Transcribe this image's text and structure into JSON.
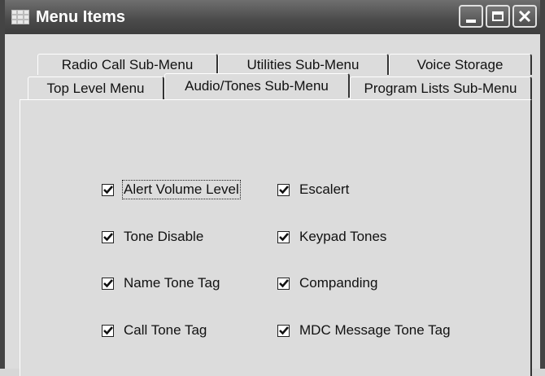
{
  "window": {
    "title": "Menu Items",
    "buttons": {
      "minimize": "minimize",
      "maximize": "maximize",
      "close": "close"
    }
  },
  "tabs": {
    "row1": [
      "Radio Call Sub-Menu",
      "Utilities Sub-Menu",
      "Voice Storage"
    ],
    "row2": [
      "Top Level Menu",
      "Audio/Tones Sub-Menu",
      "Program Lists Sub-Menu"
    ],
    "active": "Audio/Tones Sub-Menu"
  },
  "checkboxes": {
    "left": [
      {
        "label": "Alert Volume Level",
        "checked": true
      },
      {
        "label": "Tone Disable",
        "checked": true
      },
      {
        "label": "Name Tone Tag",
        "checked": true
      },
      {
        "label": "Call Tone Tag",
        "checked": true
      }
    ],
    "right": [
      {
        "label": "Escalert",
        "checked": true
      },
      {
        "label": "Keypad Tones",
        "checked": true
      },
      {
        "label": "Companding",
        "checked": true
      },
      {
        "label": "MDC Message Tone Tag",
        "checked": true
      }
    ]
  },
  "icons": {
    "app": "menu-grid-icon",
    "check": "checkmark-icon",
    "close": "close-x-icon"
  }
}
